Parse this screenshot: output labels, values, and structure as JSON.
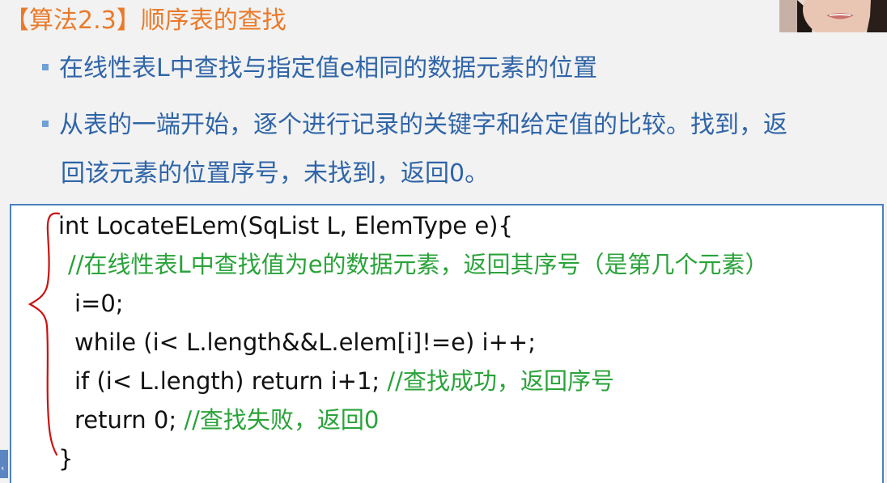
{
  "slide": {
    "title": "【算法2.3】顺序表的查找",
    "bullets": [
      "在线性表L中查找与指定值e相同的数据元素的位置",
      "从表的一端开始，逐个进行记录的关键字和给定值的比较。找到，返"
    ],
    "bullet2_continuation": "回该元素的位置序号，未找到，返回0。"
  },
  "code": {
    "line1": "int LocateELem(SqList L, ElemType e){",
    "line2_comment": "//在线性表L中查找值为e的数据元素，返回其序号（是第几个元素）",
    "line3": "i=0;",
    "line4": "while (i< L.length&&L.elem[i]!=e) i++;",
    "line5_code": "if (i< L.length) return i+1; ",
    "line5_comment": "//查找成功，返回序号",
    "line6_code": "return 0; ",
    "line6_comment": "//查找失败，返回0",
    "line7": "}"
  },
  "colors": {
    "title": "#ea7a2a",
    "bullet_text": "#2f65a8",
    "comment": "#2aa33a",
    "box_border": "#4a80bf",
    "annotation": "#cc1111"
  },
  "icons": {
    "bullet": "square-bullet-icon",
    "annotation": "hand-drawn-brace-icon",
    "scroll_left": "chevron-left-icon"
  }
}
